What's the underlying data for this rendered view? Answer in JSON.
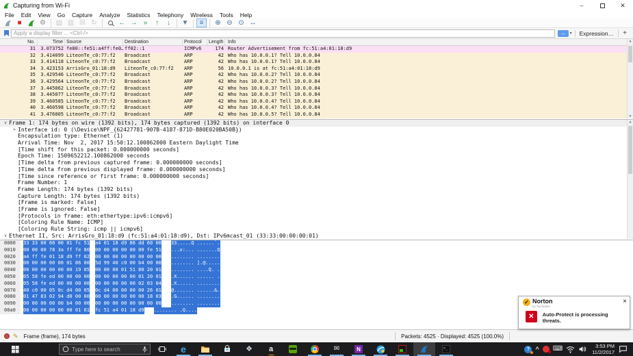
{
  "window": {
    "title": "Capturing from Wi-Fi",
    "minimize": "–",
    "close": "✕"
  },
  "menu": {
    "items": [
      "File",
      "Edit",
      "View",
      "Go",
      "Capture",
      "Analyze",
      "Statistics",
      "Telephony",
      "Wireless",
      "Tools",
      "Help"
    ]
  },
  "toolbar": {
    "icons": [
      {
        "name": "start-capture-icon",
        "kind": "fin",
        "color": "#8aa6b8"
      },
      {
        "name": "stop-capture-icon",
        "kind": "glyph",
        "glyph": "■",
        "color": "#d42a1e"
      },
      {
        "name": "restart-capture-icon",
        "kind": "fin",
        "color": "#2aa42a"
      },
      {
        "name": "capture-options-gear-icon",
        "kind": "glyph",
        "glyph": "⚙",
        "color": "#8d8d8d"
      },
      {
        "sep": true
      },
      {
        "name": "open-file-icon",
        "kind": "glyph",
        "glyph": "▤",
        "color": "#c9c9c9"
      },
      {
        "name": "save-file-icon",
        "kind": "glyph",
        "glyph": "▥",
        "color": "#c9c9c9"
      },
      {
        "name": "close-file-icon",
        "kind": "glyph",
        "glyph": "☒",
        "color": "#c9c9c9"
      },
      {
        "name": "reload-icon",
        "kind": "glyph",
        "glyph": "↻",
        "color": "#c9c9c9"
      },
      {
        "sep": true
      },
      {
        "name": "find-packet-icon",
        "kind": "mag"
      },
      {
        "name": "go-back-icon",
        "kind": "glyph",
        "glyph": "←",
        "color": "#2e9e4f"
      },
      {
        "name": "go-forward-icon",
        "kind": "glyph",
        "glyph": "→",
        "color": "#2e9e4f"
      },
      {
        "name": "go-to-packet-icon",
        "kind": "glyph",
        "glyph": "»",
        "color": "#2e9e4f"
      },
      {
        "name": "go-first-icon",
        "kind": "glyph",
        "glyph": "↑",
        "color": "#2e9e4f"
      },
      {
        "name": "go-last-icon",
        "kind": "glyph",
        "glyph": "↓",
        "color": "#2e9e4f"
      },
      {
        "sep": true
      },
      {
        "name": "autoscroll-icon",
        "kind": "glyph",
        "glyph": "▼",
        "color": "#5a7d9a"
      },
      {
        "sep": true
      },
      {
        "name": "colorize-icon",
        "kind": "glyph",
        "glyph": "≡",
        "color": "#3d6f9e",
        "active": true
      },
      {
        "sep": true
      },
      {
        "name": "zoom-in-icon",
        "kind": "glyph",
        "glyph": "⊕",
        "color": "#3d6f9e"
      },
      {
        "name": "zoom-out-icon",
        "kind": "glyph",
        "glyph": "⊖",
        "color": "#3d6f9e"
      },
      {
        "name": "zoom-original-icon",
        "kind": "glyph",
        "glyph": "⊙",
        "color": "#3d6f9e"
      },
      {
        "name": "resize-columns-icon",
        "kind": "glyph",
        "glyph": "↔",
        "color": "#3d6f9e"
      }
    ]
  },
  "filter": {
    "placeholder": "Apply a display filter ... <Ctrl-/>",
    "apply_glyph": "→",
    "caret": "▾",
    "expression_label": "Expression…",
    "add_label": "+"
  },
  "packet_list": {
    "columns": [
      "No.",
      "Time",
      "Source",
      "Destination",
      "Protocol",
      "Length",
      "Info"
    ],
    "rows": [
      {
        "no": "31",
        "time": "3.073752",
        "source": "fe80::fe51:a4ff:fe0…",
        "destination": "ff02::1",
        "protocol": "ICMPv6",
        "length": "174",
        "info": "Router Advertisement from fc:51:a4:01:18:d9",
        "color": "icmp"
      },
      {
        "no": "32",
        "time": "3.414099",
        "source": "LiteonTe_c0:77:f2",
        "destination": "Broadcast",
        "protocol": "ARP",
        "length": "42",
        "info": "Who has 10.0.0.1? Tell 10.0.0.84",
        "color": "arp"
      },
      {
        "no": "33",
        "time": "3.414118",
        "source": "LiteonTe_c0:77:f2",
        "destination": "Broadcast",
        "protocol": "ARP",
        "length": "42",
        "info": "Who has 10.0.0.1? Tell 10.0.0.84",
        "color": "arp"
      },
      {
        "no": "34",
        "time": "3.423153",
        "source": "ArrisGro_01:18:d9",
        "destination": "LiteonTe_c0:77:f2",
        "protocol": "ARP",
        "length": "56",
        "info": "10.0.0.1 is at fc:51:a4:01:18:d9",
        "color": "arp"
      },
      {
        "no": "35",
        "time": "3.429546",
        "source": "LiteonTe_c0:77:f2",
        "destination": "Broadcast",
        "protocol": "ARP",
        "length": "42",
        "info": "Who has 10.0.0.2? Tell 10.0.0.84",
        "color": "arp"
      },
      {
        "no": "36",
        "time": "3.429564",
        "source": "LiteonTe_c0:77:f2",
        "destination": "Broadcast",
        "protocol": "ARP",
        "length": "42",
        "info": "Who has 10.0.0.2? Tell 10.0.0.84",
        "color": "arp"
      },
      {
        "no": "37",
        "time": "3.445062",
        "source": "LiteonTe_c0:77:f2",
        "destination": "Broadcast",
        "protocol": "ARP",
        "length": "42",
        "info": "Who has 10.0.0.3? Tell 10.0.0.84",
        "color": "arp"
      },
      {
        "no": "38",
        "time": "3.445077",
        "source": "LiteonTe_c0:77:f2",
        "destination": "Broadcast",
        "protocol": "ARP",
        "length": "42",
        "info": "Who has 10.0.0.3? Tell 10.0.0.84",
        "color": "arp"
      },
      {
        "no": "39",
        "time": "3.460585",
        "source": "LiteonTe_c0:77:f2",
        "destination": "Broadcast",
        "protocol": "ARP",
        "length": "42",
        "info": "Who has 10.0.0.4? Tell 10.0.0.84",
        "color": "arp"
      },
      {
        "no": "40",
        "time": "3.460598",
        "source": "LiteonTe_c0:77:f2",
        "destination": "Broadcast",
        "protocol": "ARP",
        "length": "42",
        "info": "Who has 10.0.0.4? Tell 10.0.0.84",
        "color": "arp"
      },
      {
        "no": "41",
        "time": "3.476005",
        "source": "LiteonTe_c0:77:f2",
        "destination": "Broadcast",
        "protocol": "ARP",
        "length": "42",
        "info": "Who has 10.0.0.5? Tell 10.0.0.84",
        "color": "arp"
      }
    ]
  },
  "detail_pane": {
    "lines": [
      {
        "e": "v",
        "ind": 0,
        "t": "Frame 1: 174 bytes on wire (1392 bits), 174 bytes captured (1392 bits) on interface 0",
        "sel": true
      },
      {
        "e": ">",
        "ind": 1,
        "t": "Interface id: 0 (\\Device\\NPF_{62427781-907B-4187-871D-B80E020BA50B})"
      },
      {
        "e": "",
        "ind": 1,
        "t": "Encapsulation type: Ethernet (1)"
      },
      {
        "e": "",
        "ind": 1,
        "t": "Arrival Time: Nov  2, 2017 15:50:12.100862000 Eastern Daylight Time"
      },
      {
        "e": "",
        "ind": 1,
        "t": "[Time shift for this packet: 0.000000000 seconds]"
      },
      {
        "e": "",
        "ind": 1,
        "t": "Epoch Time: 1509652212.100862000 seconds"
      },
      {
        "e": "",
        "ind": 1,
        "t": "[Time delta from previous captured frame: 0.000000000 seconds]"
      },
      {
        "e": "",
        "ind": 1,
        "t": "[Time delta from previous displayed frame: 0.000000000 seconds]"
      },
      {
        "e": "",
        "ind": 1,
        "t": "[Time since reference or first frame: 0.000000000 seconds]"
      },
      {
        "e": "",
        "ind": 1,
        "t": "Frame Number: 1"
      },
      {
        "e": "",
        "ind": 1,
        "t": "Frame Length: 174 bytes (1392 bits)"
      },
      {
        "e": "",
        "ind": 1,
        "t": "Capture Length: 174 bytes (1392 bits)"
      },
      {
        "e": "",
        "ind": 1,
        "t": "[Frame is marked: False]"
      },
      {
        "e": "",
        "ind": 1,
        "t": "[Frame is ignored: False]"
      },
      {
        "e": "",
        "ind": 1,
        "t": "[Protocols in frame: eth:ethertype:ipv6:icmpv6]"
      },
      {
        "e": "",
        "ind": 1,
        "t": "[Coloring Rule Name: ICMP]"
      },
      {
        "e": "",
        "ind": 1,
        "t": "[Coloring Rule String: icmp || icmpv6]"
      },
      {
        "e": "v",
        "ind": 0,
        "t": "Ethernet II, Src: ArrisGro_01:18:d9 (fc:51:a4:01:18:d9), Dst: IPv6mcast_01 (33:33:00:00:00:01)"
      }
    ]
  },
  "hex_pane": {
    "rows": [
      {
        "o": "0000",
        "h1": "33 33 00 00 00 01 fc 51",
        "h2": "a4 01 18 d9 86 dd 60 00",
        "a": "33.....Q ......`."
      },
      {
        "o": "0010",
        "h1": "00 00 00 78 3a ff fe 80",
        "h2": "00 00 00 00 00 00 fe 51",
        "a": "...x:... .......Q"
      },
      {
        "o": "0020",
        "h1": "a4 ff fe 01 18 d9 ff 02",
        "h2": "00 00 00 00 00 00 00 00",
        "a": "........ ........"
      },
      {
        "o": "0030",
        "h1": "00 00 00 00 00 01 86 00",
        "h2": "5d 99 40 c0 00 b4 00 00",
        "a": "........ ].@....."
      },
      {
        "o": "0040",
        "h1": "00 00 00 00 00 00 19 05",
        "h2": "00 00 00 01 51 80 20 01",
        "a": "........ ....Q. ."
      },
      {
        "o": "0050",
        "h1": "05 58 fe ed 00 00 00 00",
        "h2": "00 00 00 00 00 01 20 01",
        "a": ".X...... ...... ."
      },
      {
        "o": "0060",
        "h1": "05 58 fe ed 00 00 00 00",
        "h2": "00 00 00 00 00 02 03 04",
        "a": ".X...... ........"
      },
      {
        "o": "0070",
        "h1": "40 c0 00 05 0c d4 00 05",
        "h2": "0c d4 00 00 00 00 26 01",
        "a": "@....... ......&."
      },
      {
        "o": "0080",
        "h1": "01 47 83 02 94 d0 00 00",
        "h2": "00 00 00 00 00 00 18 03",
        "a": ".G...... ........"
      },
      {
        "o": "0090",
        "h1": "00 00 00 00 00 b4 00 00",
        "h2": "00 00 00 00 00 00 00 00",
        "a": "........ ........"
      },
      {
        "o": "00a0",
        "h1": "00 00 00 00 00 00 01 01",
        "h2": "fc 51 a4 01 18 d9",
        "a": "........ .Q...."
      }
    ]
  },
  "status_bar": {
    "left": "Frame (frame), 174 bytes",
    "packets": "Packets: 4525 · Displayed: 4525 (100.0%)"
  },
  "norton": {
    "check": "✓",
    "brand": "Norton",
    "sub": "by Symantec",
    "close": "×",
    "threat_glyph": "✕",
    "message": "Auto-Protect is processing threats."
  },
  "taskbar": {
    "search_placeholder": "Type here to search",
    "clock_time": "3:53 PM",
    "clock_date": "11/2/2017",
    "apps": [
      {
        "name": "edge-icon",
        "kind": "edge",
        "underline": true
      },
      {
        "name": "file-explorer-icon",
        "kind": "folder",
        "underline": true
      },
      {
        "name": "store-icon",
        "kind": "store"
      },
      {
        "name": "dropbox-icon",
        "kind": "dropbox"
      },
      {
        "name": "amazon-icon",
        "kind": "amazon"
      },
      {
        "name": "green-app-icon",
        "kind": "spy"
      },
      {
        "name": "chrome-icon",
        "kind": "chrome",
        "underline": true
      },
      {
        "name": "mail-icon",
        "kind": "mail",
        "underline": true
      },
      {
        "name": "onenote-icon",
        "kind": "onenote",
        "underline": true
      },
      {
        "name": "paint3d-icon",
        "kind": "paint",
        "underline": true
      },
      {
        "name": "game-app-icon",
        "kind": "game",
        "underline": true
      },
      {
        "name": "wireshark-icon",
        "kind": "wireshark",
        "underline": true,
        "active": true
      },
      {
        "name": "command-prompt-icon",
        "kind": "cmd",
        "underline": true
      }
    ],
    "tray": [
      {
        "name": "help-tray-icon",
        "kind": "help"
      },
      {
        "name": "show-hidden-icons-chevron",
        "kind": "chev"
      },
      {
        "name": "norton-tray-icon",
        "kind": "ntray"
      },
      {
        "name": "keyboard-tray-icon",
        "kind": "kbd"
      },
      {
        "name": "wifi-tray-icon",
        "kind": "wifi"
      },
      {
        "name": "volume-tray-icon",
        "kind": "speaker"
      }
    ]
  }
}
